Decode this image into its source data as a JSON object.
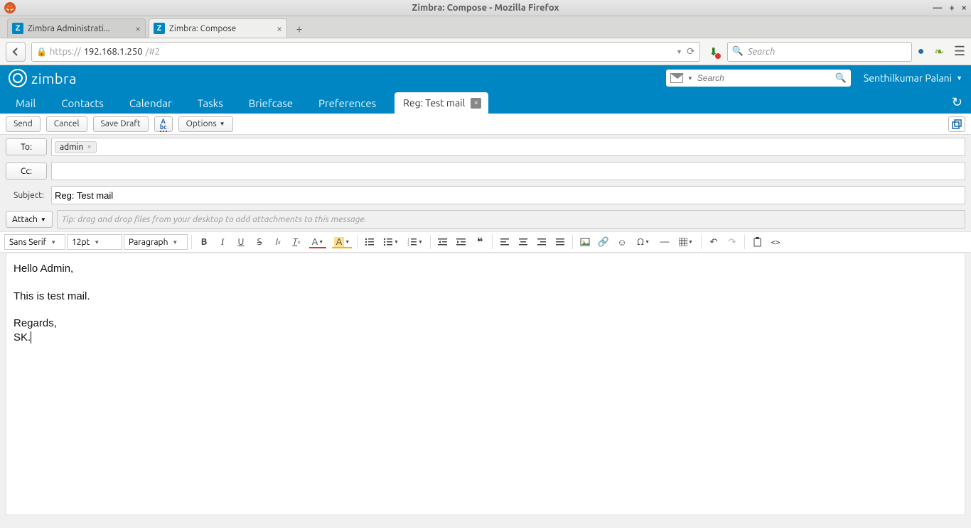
{
  "os": {
    "window_title": "Zimbra: Compose - Mozilla Firefox"
  },
  "browser": {
    "tabs": [
      {
        "label": "Zimbra Administrati...",
        "active": false
      },
      {
        "label": "Zimbra: Compose",
        "active": true
      }
    ],
    "url_prefix": "https://",
    "url_host": "192.168.1.250",
    "url_path": "/#2",
    "search_placeholder": "Search"
  },
  "zimbra": {
    "brand": "zimbra",
    "search_placeholder": "Search",
    "user": "Senthilkumar Palani",
    "tabs": {
      "mail": "Mail",
      "contacts": "Contacts",
      "calendar": "Calendar",
      "tasks": "Tasks",
      "briefcase": "Briefcase",
      "preferences": "Preferences",
      "compose": "Reg: Test mail"
    }
  },
  "compose": {
    "send": "Send",
    "cancel": "Cancel",
    "save_draft": "Save Draft",
    "options": "Options",
    "to_label": "To:",
    "cc_label": "Cc:",
    "subject_label": "Subject:",
    "attach_label": "Attach",
    "to_chip": "admin",
    "cc_value": "",
    "subject_value": "Reg: Test mail",
    "attach_tip": "Tip: drag and drop files from your desktop to add attachments to this message."
  },
  "rte": {
    "font": "Sans Serif",
    "size": "12pt",
    "block": "Paragraph"
  },
  "body": {
    "l1": "Hello Admin,",
    "l2": "This is test mail.",
    "l3": "Regards,",
    "l4": "SK."
  }
}
